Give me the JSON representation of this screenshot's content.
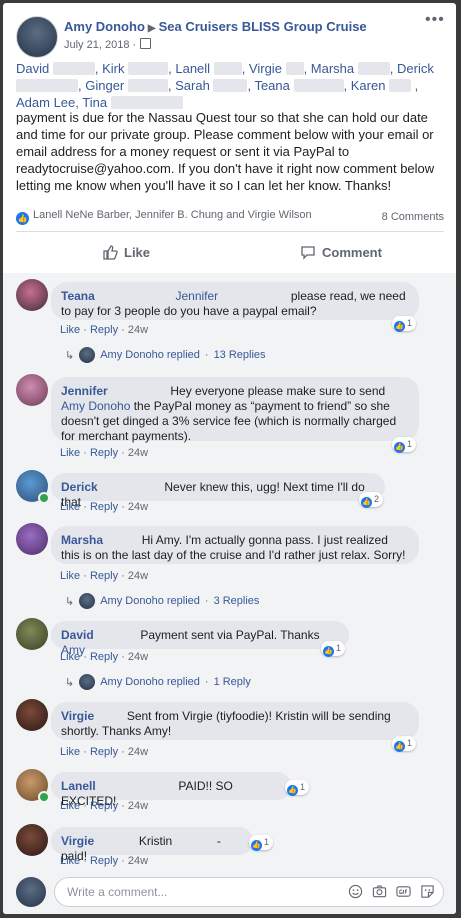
{
  "post": {
    "author": "Amy Donoho",
    "group": "Sea Cruisers BLISS Group Cruise",
    "date": "July 21, 2018 ·",
    "tags": [
      "David",
      "Kirk",
      "Lanell",
      "Virgie",
      "Marsha",
      "Derick",
      "Ginger",
      "Sarah",
      "Teana",
      "Karen",
      "Adam Lee,",
      "Tina"
    ],
    "body": "payment is due for the Nassau Quest tour so that she can hold our date and time for our private group. Please comment below with your email or email address for a money request or sent it via PayPal to readytocruise@yahoo.com. If you don't have it right now comment below letting me know when you'll have it so I can let her know. Thanks!",
    "reactions_text": "Lanell NeNe Barber, Jennifer B. Chung and Virgie Wilson",
    "comments_count": "8 Comments",
    "like_label": "Like",
    "comment_label": "Comment"
  },
  "comments": [
    {
      "name": "Teana",
      "mention": "Jennifer",
      "text": "please read, we need to pay for 3 people do you have a paypal email?",
      "reacts": "1",
      "like": "Like",
      "reply": "Reply",
      "time": "24w",
      "replied_by": "Amy Donoho replied",
      "replies": "13 Replies"
    },
    {
      "name": "Jennifer",
      "text_a": "Hey everyone please make sure to send",
      "mention": "Amy Donoho",
      "text_b": "the PayPal money as “payment to friend” so she doesn't get dinged a 3% service fee (which is normally charged for merchant payments).",
      "reacts": "1",
      "like": "Like",
      "reply": "Reply",
      "time": "24w"
    },
    {
      "name": "Derick",
      "text": "Never knew this, ugg! Next time I'll do that",
      "reacts": "2",
      "like": "Like",
      "reply": "Reply",
      "time": "24w"
    },
    {
      "name": "Marsha",
      "text": "Hi Amy. I'm actually gonna pass. I just realized this is on the last day of the cruise and I'd rather just relax. Sorry!",
      "like": "Like",
      "reply": "Reply",
      "time": "24w",
      "replied_by": "Amy Donoho replied",
      "replies": "3 Replies"
    },
    {
      "name": "David",
      "text": "Payment sent via PayPal. Thanks",
      "mention": "Amy",
      "reacts": "1",
      "like": "Like",
      "reply": "Reply",
      "time": "24w",
      "replied_by": "Amy Donoho replied",
      "replies": "1 Reply"
    },
    {
      "name": "Virgie",
      "text": "Sent from Virgie (tiyfoodie)! Kristin will be sending shortly. Thanks Amy!",
      "reacts": "1",
      "like": "Like",
      "reply": "Reply",
      "time": "24w"
    },
    {
      "name": "Lanell",
      "text": "PAID!! SO EXCITED!",
      "reacts": "1",
      "like": "Like",
      "reply": "Reply",
      "time": "24w"
    },
    {
      "name": "Virgie",
      "mention": "Kristin",
      "text": "- paid!",
      "reacts": "1",
      "like": "Like",
      "reply": "Reply",
      "time": "24w"
    }
  ],
  "write": {
    "placeholder": "Write a comment..."
  },
  "colors": {
    "link": "#385898",
    "bubble": "#e4e6eb",
    "like_blue": "#1877f2",
    "online": "#31a24c"
  },
  "icons": [
    "more-icon",
    "globe-icon",
    "like-reaction-icon",
    "thumbs-up-icon",
    "comment-icon",
    "reply-arrow-icon",
    "emoji-icon",
    "camera-icon",
    "gif-icon",
    "sticker-icon"
  ]
}
